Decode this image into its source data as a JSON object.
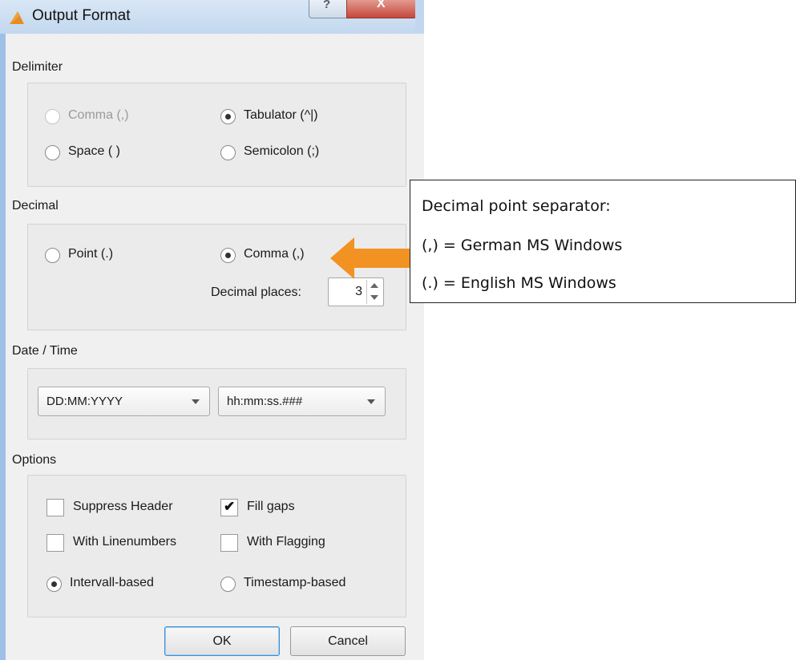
{
  "window": {
    "title": "Output Format",
    "help_glyph": "?",
    "close_glyph": "X"
  },
  "delimiter": {
    "label": "Delimiter",
    "options": [
      {
        "label": "Comma (,)",
        "checked": false,
        "disabled": true
      },
      {
        "label": "Tabulator (^|)",
        "checked": true,
        "disabled": false
      },
      {
        "label": "Space ( )",
        "checked": false,
        "disabled": false
      },
      {
        "label": "Semicolon (;)",
        "checked": false,
        "disabled": false
      }
    ]
  },
  "decimal": {
    "label": "Decimal",
    "options": [
      {
        "label": "Point (.)",
        "checked": false
      },
      {
        "label": "Comma (,)",
        "checked": true
      }
    ],
    "places_label": "Decimal places:",
    "places_value": "3"
  },
  "datetime": {
    "label": "Date / Time",
    "date_format": "DD:MM:YYYY",
    "time_format": "hh:mm:ss.###"
  },
  "options": {
    "label": "Options",
    "checkboxes": [
      {
        "label": "Suppress Header",
        "checked": false
      },
      {
        "label": "Fill gaps",
        "checked": true
      },
      {
        "label": "With Linenumbers",
        "checked": false
      },
      {
        "label": "With Flagging",
        "checked": false
      }
    ],
    "radios": [
      {
        "label": "Intervall-based",
        "checked": true
      },
      {
        "label": "Timestamp-based",
        "checked": false
      }
    ]
  },
  "buttons": {
    "ok": "OK",
    "cancel": "Cancel"
  },
  "callout": {
    "lines": [
      "Decimal point separator:",
      "(,) = German MS Windows",
      "(.) = English MS Windows"
    ],
    "arrow_color": "#f29222"
  }
}
